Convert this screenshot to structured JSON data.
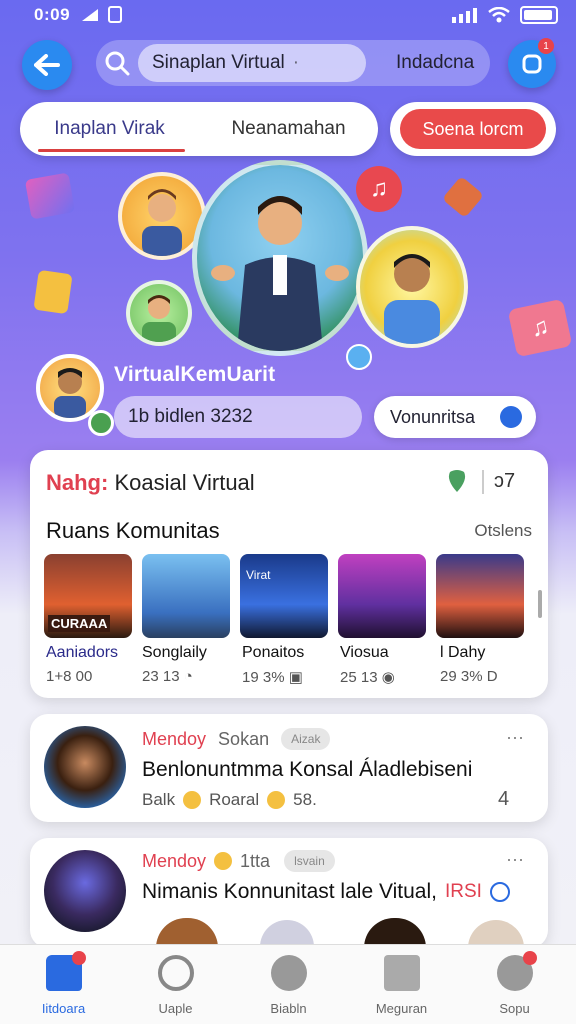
{
  "status_bar": {
    "time": "0:09"
  },
  "header": {
    "search_text": "Sinaplan Virtual",
    "search_dots": "·",
    "search_right": "Indadcna"
  },
  "tabs": [
    {
      "label": "Inaplan Virak"
    },
    {
      "label": "Neanamahan"
    }
  ],
  "cta": {
    "label": "Soena lorcm"
  },
  "profile": {
    "name": "VirtualKemUarit",
    "info": "1b bidlen 3232",
    "community_button": "Vonunritsa"
  },
  "community_card": {
    "title_prefix": "Nahg:",
    "title": "Koasial Virtual",
    "stat_icon": "ↄ7",
    "section_label": "Ruans Komunitas",
    "section_more": "Otslens",
    "rooms": [
      {
        "name": "Aaniadors",
        "count": "1+8 00",
        "poster": "CURAAA"
      },
      {
        "name": "Songlaily",
        "count": "23 13",
        "poster": ""
      },
      {
        "name": "Ponaitos",
        "count": "19 3%",
        "poster": "Virat"
      },
      {
        "name": "Viosua",
        "count": "25 13",
        "poster": ""
      },
      {
        "name": "l Dahy",
        "count": "29 3%",
        "poster": ""
      }
    ]
  },
  "posts": [
    {
      "name": "Mendoy",
      "handle": "Sokan",
      "tag": "Aizak",
      "text": "Benlonuntmma Konsal Áladlebiseni",
      "meta_a": "Balk",
      "meta_b": "Roaral",
      "meta_c": "58.",
      "count": "4"
    },
    {
      "name": "Mendoy",
      "handle": "1tta",
      "tag": "lsvain",
      "text": "Nimanis Konnunitast lale Vitual,",
      "tag2": "IRSI"
    }
  ],
  "bottom_nav": [
    {
      "label": "Iitdoara",
      "icon": "home-icon"
    },
    {
      "label": "Uaple",
      "icon": "search-icon"
    },
    {
      "label": "Biabln",
      "icon": "chat-icon"
    },
    {
      "label": "Meguran",
      "icon": "image-icon"
    },
    {
      "label": "Sopu",
      "icon": "profile-icon"
    }
  ],
  "colors": {
    "accent": "#2a8af0",
    "brand_red": "#e94a4a",
    "bg_top": "#6a6af0"
  }
}
